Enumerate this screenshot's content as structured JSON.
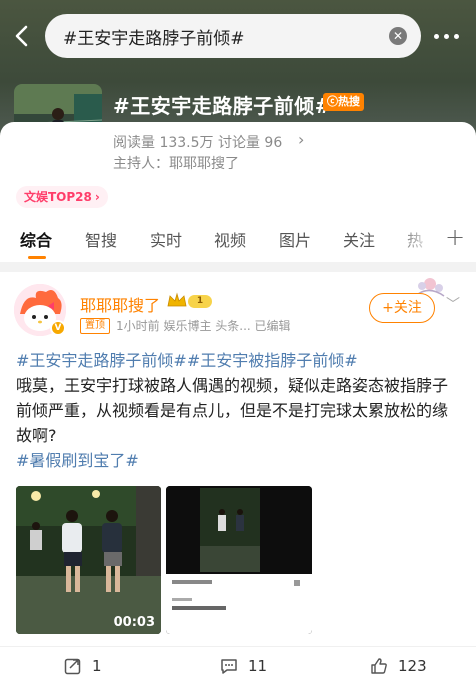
{
  "header": {
    "search_query": "#王安宇走路脖子前倾#",
    "clear_icon": "close-circle-icon",
    "back_icon": "back-chevron-icon",
    "more_icon": "more-dots-icon"
  },
  "topic": {
    "title": "#王安宇走路脖子前倾#",
    "hot_badge": "热搜",
    "stats": "阅读量 133.5万  讨论量 96",
    "host": "主持人：耶耶耶搜了",
    "rank": "文娱TOP28",
    "rank_arrow": "›"
  },
  "tabs": [
    {
      "label": "综合",
      "active": true
    },
    {
      "label": "智搜",
      "active": false
    },
    {
      "label": "实时",
      "active": false
    },
    {
      "label": "视频",
      "active": false
    },
    {
      "label": "图片",
      "active": false
    },
    {
      "label": "关注",
      "active": false
    },
    {
      "label": "热",
      "active": false
    }
  ],
  "post": {
    "author": "耶耶耶搜了",
    "level": "1",
    "pin_label": "置顶",
    "meta": "1小时前  娱乐博主 头条...  已编辑",
    "follow_label": "+关注",
    "hashtags_top": "#王安宇走路脖子前倾##王安宇被指脖子前倾#",
    "body": "哦莫，王安宇打球被路人偶遇的视频，疑似走路姿态被指脖子前倾严重，从视频看是有点儿，但是不是打完球太累放松的缘故啊?",
    "hashtag_bottom": "#暑假刷到宝了#",
    "video_duration": "00:03"
  },
  "actions": {
    "repost": "1",
    "comments": "11",
    "likes": "123"
  },
  "colors": {
    "accent": "#ff8200",
    "hashtag": "#507daf",
    "rank": "#ff3d6a"
  }
}
